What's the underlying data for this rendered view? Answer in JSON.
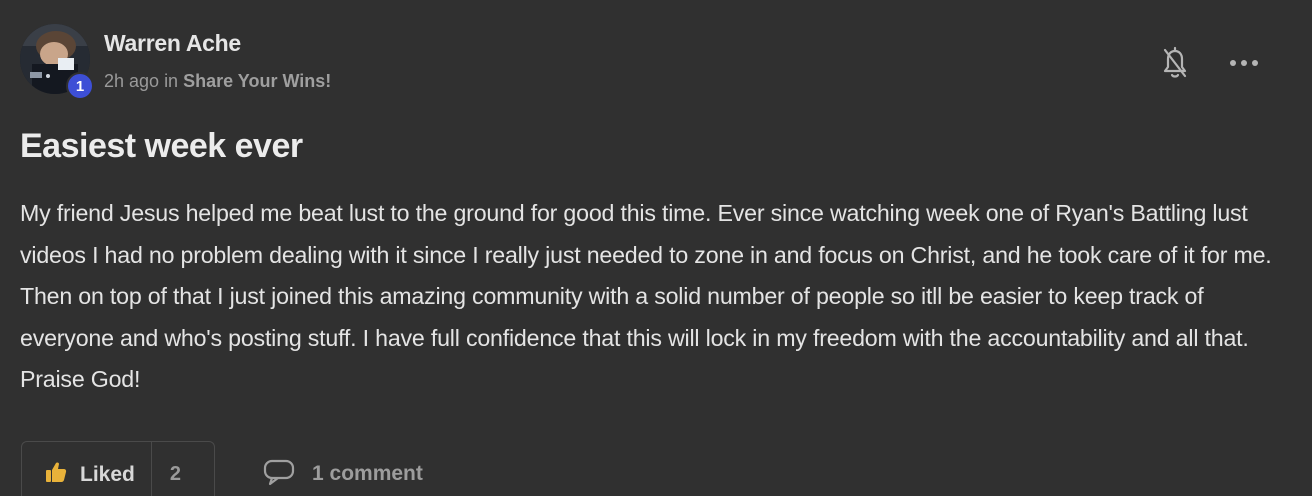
{
  "post": {
    "author": {
      "name": "Warren Ache",
      "level": "1"
    },
    "meta": {
      "time": "2h ago",
      "in_word": "in",
      "category": "Share Your Wins!"
    },
    "title": "Easiest week ever",
    "body": "My friend Jesus helped me beat lust to the ground for good this time. Ever since watching week one of Ryan's Battling lust videos I had no problem dealing with it since I really just needed to zone in and focus on Christ, and he took care of it for me. Then on top of that I just joined this amazing community with a solid number of people so itll be easier to keep track of everyone and who's posting stuff. I have full confidence that this will lock in my freedom with the accountability and all that. Praise God!",
    "actions": {
      "like_label": "Liked",
      "like_count": "2",
      "comment_label": "1 comment"
    },
    "icons": {
      "bell": "bell-off-icon",
      "more": "more-horizontal-icon",
      "thumb": "thumbs-up-icon",
      "comment": "comment-icon"
    },
    "colors": {
      "background": "#303030",
      "level_badge": "#3d4fd6",
      "thumb": "#e8b23a"
    }
  }
}
